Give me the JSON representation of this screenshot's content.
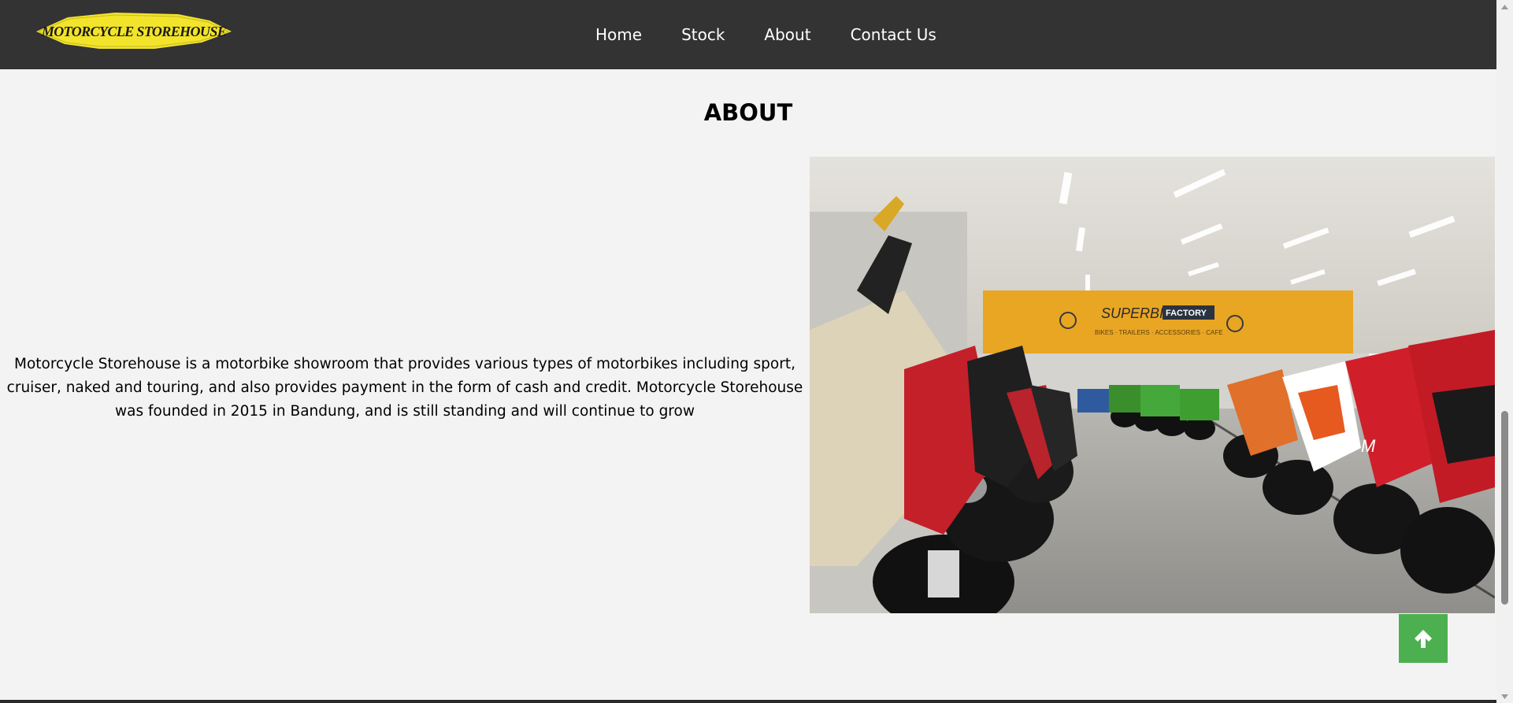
{
  "brand": {
    "logo_text": "MOTORCYCLE STOREHOUSE"
  },
  "nav": {
    "items": [
      {
        "label": "Home"
      },
      {
        "label": "Stock"
      },
      {
        "label": "About"
      },
      {
        "label": "Contact Us"
      }
    ]
  },
  "about": {
    "title": "ABOUT",
    "description": "Motorcycle Storehouse is a motorbike showroom that provides various types of motorbikes including sport, cruiser, naked and touring, and also provides payment in the form of cash and credit. Motorcycle Storehouse was founded in 2015 in Bandung, and is still standing and will continue to grow",
    "image": {
      "sign_brand": "SUPERBIKE",
      "sign_factory": "FACTORY",
      "sign_sub": "BIKES · TRAILERS · ACCESSORIES · CAFE"
    }
  },
  "back_to_top": {
    "icon": "arrow-up-icon"
  },
  "colors": {
    "navbar": "#333333",
    "page_background": "#f3f3f3",
    "nav_text": "#ffffff",
    "logo_yellow": "#f2e42b",
    "back_to_top": "#4caf50"
  }
}
